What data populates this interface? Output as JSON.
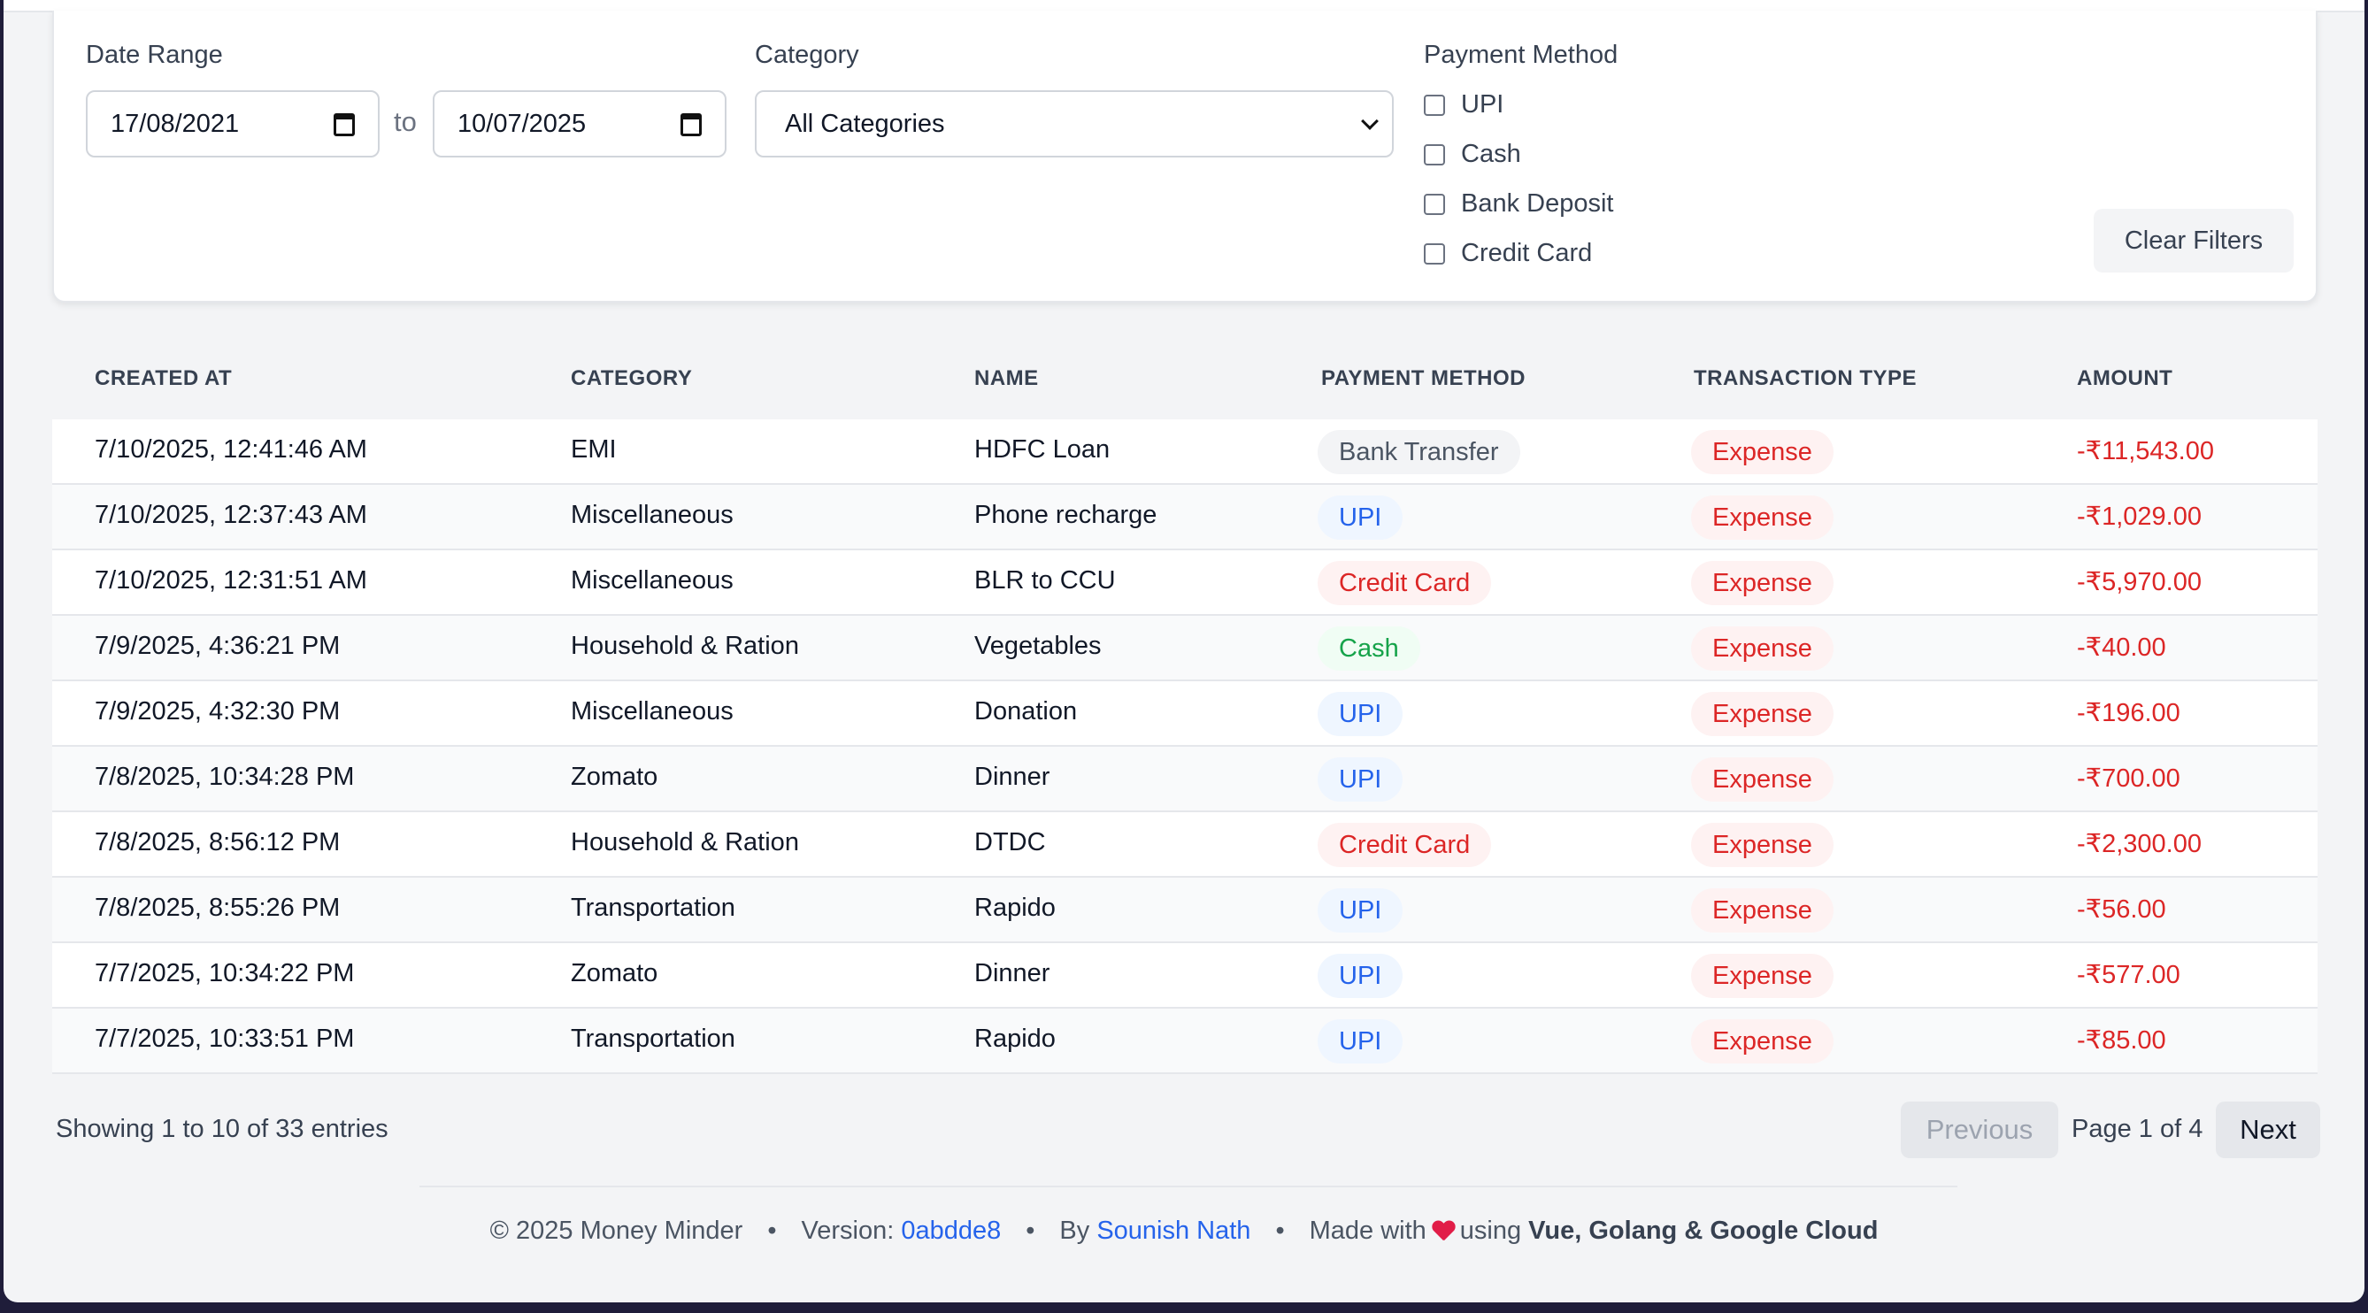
{
  "filters": {
    "date_range_label": "Date Range",
    "date_from": "17/08/2021",
    "to_label": "to",
    "date_to": "10/07/2025",
    "category_label": "Category",
    "category_selected": "All Categories",
    "payment_method_label": "Payment Method",
    "payment_methods": [
      "UPI",
      "Cash",
      "Bank Deposit",
      "Credit Card"
    ],
    "clear_label": "Clear Filters"
  },
  "table": {
    "headers": [
      "CREATED AT",
      "CATEGORY",
      "NAME",
      "PAYMENT METHOD",
      "TRANSACTION TYPE",
      "AMOUNT"
    ],
    "rows": [
      {
        "created": "7/10/2025, 12:41:46 AM",
        "category": "EMI",
        "name": "HDFC Loan",
        "method": "Bank Transfer",
        "type": "Expense",
        "amount": "-₹11,543.00"
      },
      {
        "created": "7/10/2025, 12:37:43 AM",
        "category": "Miscellaneous",
        "name": "Phone recharge",
        "method": "UPI",
        "type": "Expense",
        "amount": "-₹1,029.00"
      },
      {
        "created": "7/10/2025, 12:31:51 AM",
        "category": "Miscellaneous",
        "name": "BLR to CCU",
        "method": "Credit Card",
        "type": "Expense",
        "amount": "-₹5,970.00"
      },
      {
        "created": "7/9/2025, 4:36:21 PM",
        "category": "Household & Ration",
        "name": "Vegetables",
        "method": "Cash",
        "type": "Expense",
        "amount": "-₹40.00"
      },
      {
        "created": "7/9/2025, 4:32:30 PM",
        "category": "Miscellaneous",
        "name": "Donation",
        "method": "UPI",
        "type": "Expense",
        "amount": "-₹196.00"
      },
      {
        "created": "7/8/2025, 10:34:28 PM",
        "category": "Zomato",
        "name": "Dinner",
        "method": "UPI",
        "type": "Expense",
        "amount": "-₹700.00"
      },
      {
        "created": "7/8/2025, 8:56:12 PM",
        "category": "Household & Ration",
        "name": "DTDC",
        "method": "Credit Card",
        "type": "Expense",
        "amount": "-₹2,300.00"
      },
      {
        "created": "7/8/2025, 8:55:26 PM",
        "category": "Transportation",
        "name": "Rapido",
        "method": "UPI",
        "type": "Expense",
        "amount": "-₹56.00"
      },
      {
        "created": "7/7/2025, 10:34:22 PM",
        "category": "Zomato",
        "name": "Dinner",
        "method": "UPI",
        "type": "Expense",
        "amount": "-₹577.00"
      },
      {
        "created": "7/7/2025, 10:33:51 PM",
        "category": "Transportation",
        "name": "Rapido",
        "method": "UPI",
        "type": "Expense",
        "amount": "-₹85.00"
      }
    ]
  },
  "method_styles": {
    "Bank Transfer": {
      "bg": "#f3f4f6",
      "fg": "#4b5563"
    },
    "UPI": {
      "bg": "#eff6ff",
      "fg": "#2563eb"
    },
    "Credit Card": {
      "bg": "#fef2f2",
      "fg": "#dc2626"
    },
    "Cash": {
      "bg": "#f0fdf4",
      "fg": "#16a34a"
    }
  },
  "type_style": {
    "bg": "#fef2f2",
    "fg": "#dc2626"
  },
  "pagination": {
    "showing": "Showing 1 to 10 of 33 entries",
    "previous": "Previous",
    "page_info": "Page 1 of 4",
    "next": "Next"
  },
  "footer": {
    "copyright": "© 2025 Money Minder",
    "version_label": "Version:",
    "version": "0abdde8",
    "by_label": "By",
    "author": "Sounish Nath",
    "made_with": "Made with",
    "using": "using",
    "stack": "Vue, Golang & Google Cloud",
    "separator": "•"
  }
}
